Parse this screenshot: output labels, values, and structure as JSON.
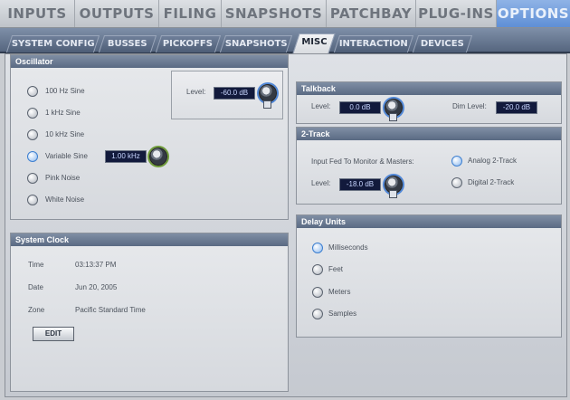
{
  "top_tabs": {
    "inputs": "INPUTS",
    "outputs": "OUTPUTS",
    "filing": "FILING",
    "snapshots": "SNAPSHOTS",
    "patchbay": "PATCHBAY",
    "plugins": "PLUG-INS",
    "options": "OPTIONS",
    "active": "OPTIONS"
  },
  "sub_tabs": {
    "system_config": "SYSTEM CONFIG",
    "busses": "BUSSES",
    "pickoffs": "PICKOFFS",
    "snapshots": "SNAPSHOTS",
    "misc": "MISC",
    "interaction": "INTERACTION",
    "devices": "DEVICES",
    "active": "MISC"
  },
  "oscillator": {
    "title": "Oscillator",
    "options": [
      "100 Hz Sine",
      "1 kHz Sine",
      "10 kHz Sine",
      "Variable Sine",
      "Pink Noise",
      "White Noise"
    ],
    "selected": "Variable Sine",
    "variable_freq": "1.00 kHz",
    "level_label": "Level:",
    "level_value": "-60.0 dB"
  },
  "system_clock": {
    "title": "System Clock",
    "time_label": "Time",
    "time_value": "03:13:37 PM",
    "date_label": "Date",
    "date_value": "Jun 20, 2005",
    "zone_label": "Zone",
    "zone_value": "Pacific Standard Time",
    "edit_label": "EDIT"
  },
  "talkback": {
    "title": "Talkback",
    "level_label": "Level:",
    "level_value": "0.0 dB",
    "dim_label": "Dim Level:",
    "dim_value": "-20.0 dB"
  },
  "two_track": {
    "title": "2-Track",
    "input_label": "Input Fed To Monitor & Masters:",
    "level_label": "Level:",
    "level_value": "-18.0 dB",
    "options": [
      "Analog 2-Track",
      "Digital 2-Track"
    ],
    "selected": "Analog 2-Track"
  },
  "delay_units": {
    "title": "Delay Units",
    "options": [
      "Milliseconds",
      "Feet",
      "Meters",
      "Samples"
    ],
    "selected": "Milliseconds"
  }
}
